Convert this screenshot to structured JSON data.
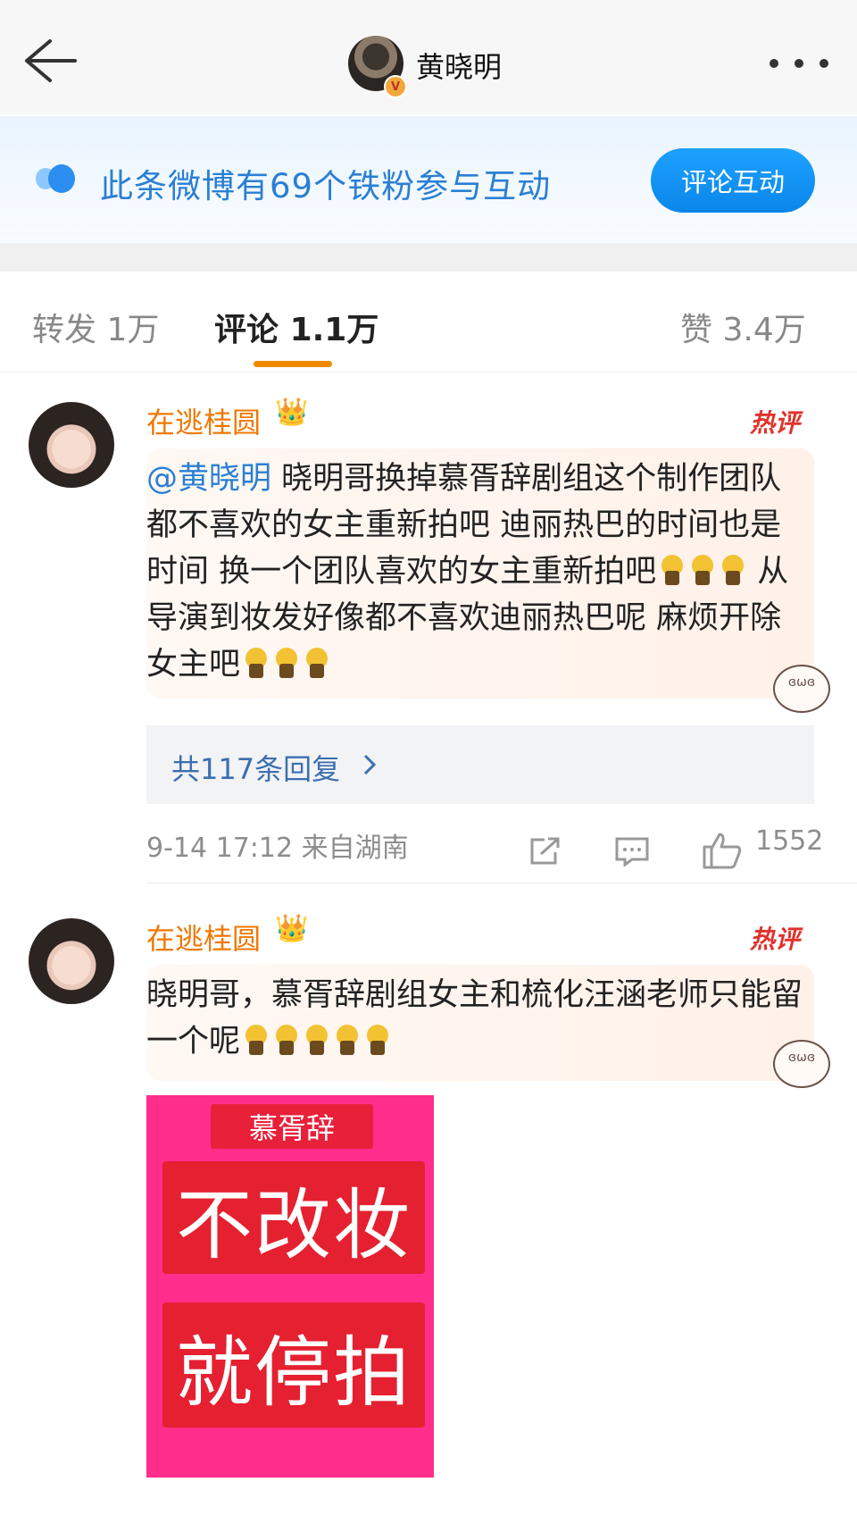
{
  "nav": {
    "title": "黄晓明",
    "verified_badge": "V"
  },
  "banner": {
    "text": "此条微博有69个铁粉参与互动",
    "button": "评论互动"
  },
  "tabs": [
    {
      "label": "转发",
      "count": "1万"
    },
    {
      "label": "评论",
      "count": "1.1万"
    },
    {
      "label": "赞",
      "count": "3.4万"
    }
  ],
  "comments": [
    {
      "user": "在逃桂圆",
      "tag": "热评",
      "mention": "@黄晓明",
      "text_parts": [
        "晓明哥换掉慕胥辞剧组这个制作团队都不喜欢的女主重新拍吧  迪丽热巴的时间也是时间  换一个团队喜欢的女主重新拍吧",
        "  从导演到妆发好像都不喜欢迪丽热巴呢  麻烦开除女主吧"
      ],
      "replies": "共117条回复",
      "time": "9-14 17:12",
      "location": "来自湖南",
      "likes": "1552"
    },
    {
      "user": "在逃桂圆",
      "tag": "热评",
      "text": "晓明哥，慕胥辞剧组女主和梳化汪涵老师只能留一个呢",
      "image": {
        "tag": "慕胥辞",
        "line1": "不改妆",
        "line2": "就停拍"
      }
    }
  ],
  "colors": {
    "accent_blue": "#2a7fd4",
    "name_orange": "#f07800",
    "hot_red": "#e0322b",
    "poster_pink": "#ff2e8c"
  }
}
